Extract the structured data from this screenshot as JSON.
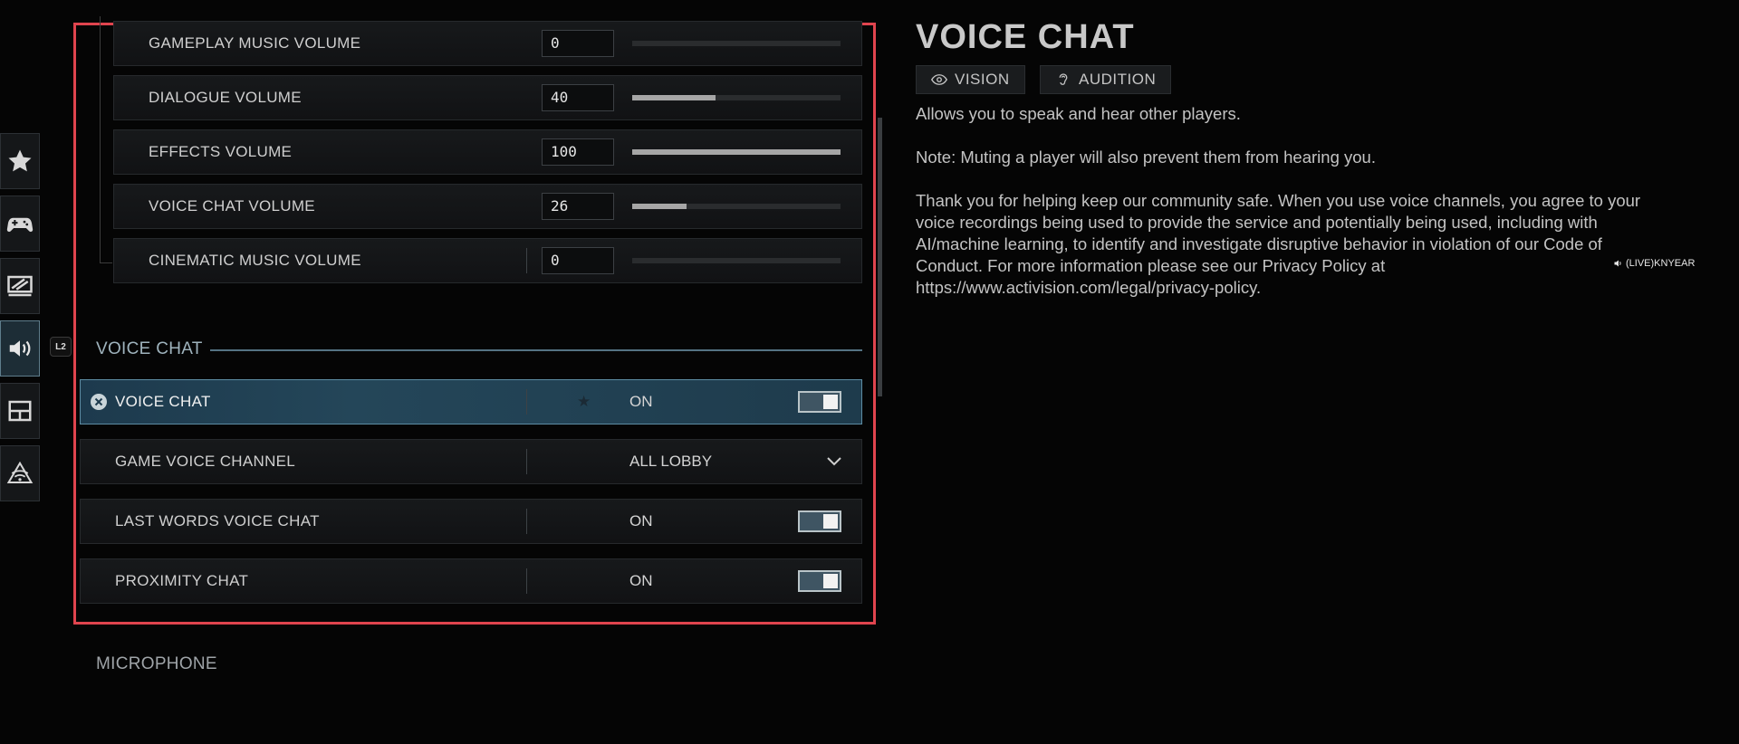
{
  "rail": {
    "items": [
      {
        "icon": "star-icon"
      },
      {
        "icon": "gamepad-icon"
      },
      {
        "icon": "display-icon"
      },
      {
        "icon": "speaker-icon",
        "active": true
      },
      {
        "icon": "layout-icon"
      },
      {
        "icon": "network-icon"
      }
    ],
    "badge": "L2"
  },
  "volumes": [
    {
      "label": "GAMEPLAY MUSIC VOLUME",
      "value": "0",
      "level": 0
    },
    {
      "label": "DIALOGUE VOLUME",
      "value": "40",
      "level": 40
    },
    {
      "label": "EFFECTS VOLUME",
      "value": "100",
      "level": 100
    },
    {
      "label": "VOICE CHAT VOLUME",
      "value": "26",
      "level": 26
    },
    {
      "label": "CINEMATIC MUSIC VOLUME",
      "value": "0",
      "level": 0
    }
  ],
  "voice_section": {
    "header": "VOICE CHAT",
    "rows": [
      {
        "label": "VOICE CHAT",
        "value": "ON",
        "control": "toggle",
        "selected": true,
        "favorite": true
      },
      {
        "label": "GAME VOICE CHANNEL",
        "value": "ALL LOBBY",
        "control": "dropdown"
      },
      {
        "label": "LAST WORDS VOICE CHAT",
        "value": "ON",
        "control": "toggle"
      },
      {
        "label": "PROXIMITY CHAT",
        "value": "ON",
        "control": "toggle"
      }
    ]
  },
  "next_section": "MICROPHONE",
  "info": {
    "title": "VOICE CHAT",
    "tags": [
      "VISION",
      "AUDITION"
    ],
    "p1": "Allows you to speak and hear other players.",
    "p2": "Note: Muting a player will also prevent them from hearing you.",
    "p3": "Thank you for helping keep our community safe. When you use voice channels, you agree to your voice recordings being used to provide the service and potentially being used, including with AI/machine learning, to identify and investigate disruptive behavior in violation of our Code of Conduct.  For more information please see our Privacy Policy at https://www.activision.com/legal/privacy-policy."
  },
  "watermark": "(LIVE)KNYEAR",
  "colors": {
    "highlight": "#e0444e",
    "accent": "#557383",
    "selected": "#244659"
  }
}
